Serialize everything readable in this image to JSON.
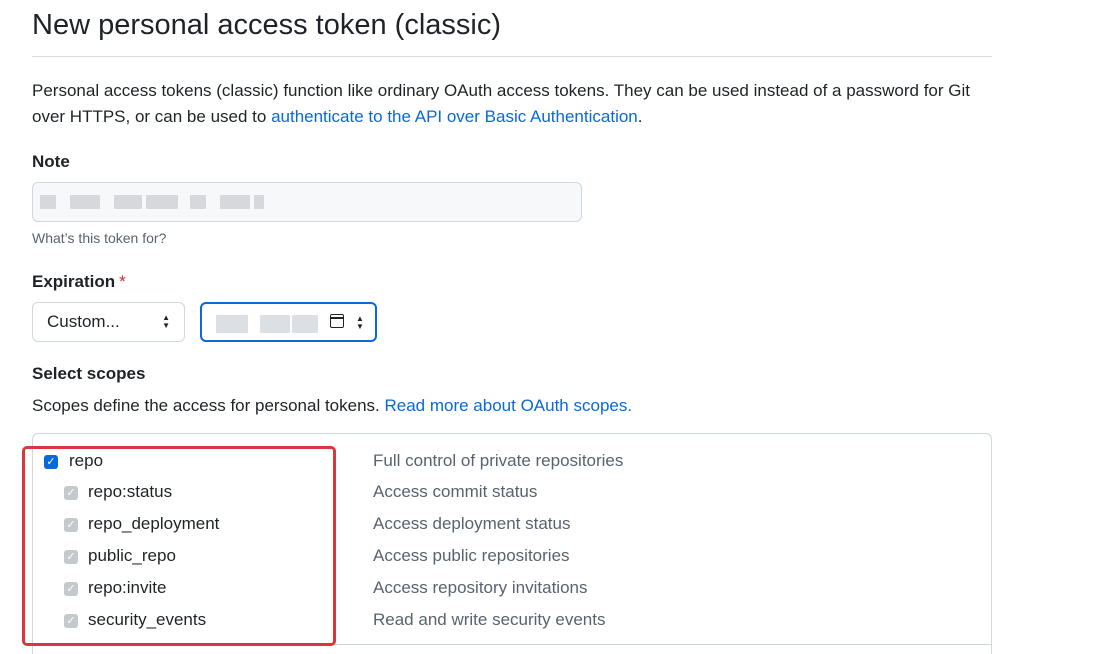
{
  "page": {
    "title": "New personal access token (classic)",
    "description_prefix": "Personal access tokens (classic) function like ordinary OAuth access tokens. They can be used instead of a password for Git over HTTPS, or can be used to ",
    "description_link": "authenticate to the API over Basic Authentication",
    "description_suffix": "."
  },
  "note": {
    "label": "Note",
    "value": "",
    "hint": "What’s this token for?"
  },
  "expiration": {
    "label": "Expiration",
    "required_mark": "*",
    "selected_option": "Custom...",
    "date_value": ""
  },
  "scopes": {
    "heading": "Select scopes",
    "description": "Scopes define the access for personal tokens. ",
    "description_link": "Read more about OAuth scopes.",
    "items": [
      {
        "name": "repo",
        "description": "Full control of private repositories",
        "checked": true,
        "disabled": false,
        "level": 0
      },
      {
        "name": "repo:status",
        "description": "Access commit status",
        "checked": true,
        "disabled": true,
        "level": 1
      },
      {
        "name": "repo_deployment",
        "description": "Access deployment status",
        "checked": true,
        "disabled": true,
        "level": 1
      },
      {
        "name": "public_repo",
        "description": "Access public repositories",
        "checked": true,
        "disabled": true,
        "level": 1
      },
      {
        "name": "repo:invite",
        "description": "Access repository invitations",
        "checked": true,
        "disabled": true,
        "level": 1
      },
      {
        "name": "security_events",
        "description": "Read and write security events",
        "checked": true,
        "disabled": true,
        "level": 1
      }
    ]
  },
  "colors": {
    "link": "#0969da",
    "checkbox_checked": "#0969da",
    "checkbox_disabled": "#c5c8cc",
    "highlight": "#d9363e",
    "required": "#d1242f"
  }
}
